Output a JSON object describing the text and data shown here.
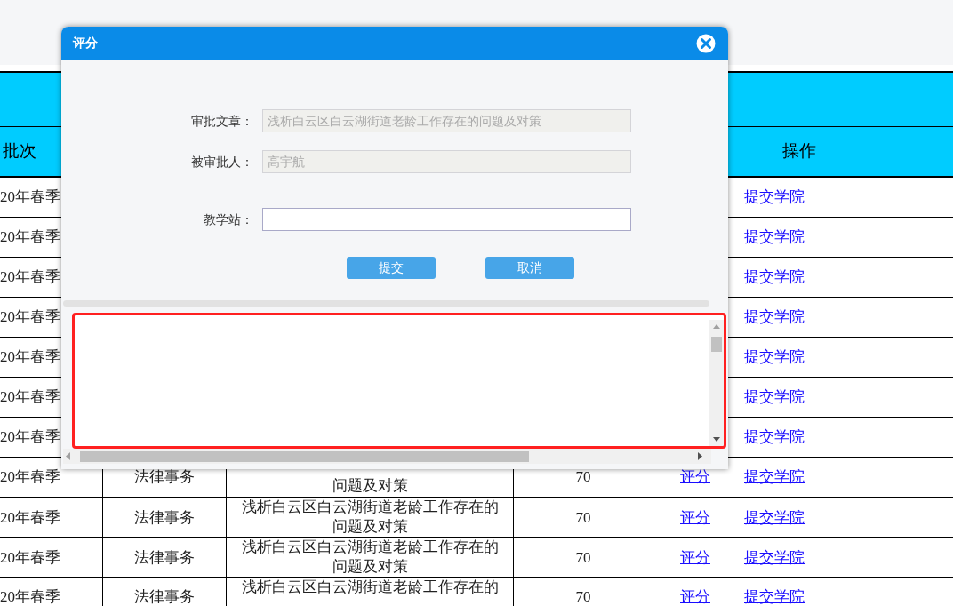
{
  "table": {
    "header": {
      "batch": "批次",
      "actions": "操作"
    },
    "rows": [
      {
        "batch": "20年春季",
        "submit_link": "提交学院"
      },
      {
        "batch": "20年春季",
        "submit_link": "提交学院"
      },
      {
        "batch": "20年春季",
        "submit_link": "提交学院"
      },
      {
        "batch": "20年春季",
        "submit_link": "提交学院"
      },
      {
        "batch": "20年春季",
        "submit_link": "提交学院"
      },
      {
        "batch": "20年春季",
        "submit_link": "提交学院"
      },
      {
        "batch": "20年春季",
        "submit_link": "提交学院"
      },
      {
        "batch": "20年春季",
        "major": "法律事务",
        "title_lines": [
          "问题及对策"
        ],
        "score": "70",
        "grade_link": "评分",
        "submit_link": "提交学院"
      },
      {
        "batch": "20年春季",
        "major": "法律事务",
        "title_lines": [
          "浅析白云区白云湖街道老龄工作存在的",
          "问题及对策"
        ],
        "score": "70",
        "grade_link": "评分",
        "submit_link": "提交学院"
      },
      {
        "batch": "20年春季",
        "major": "法律事务",
        "title_lines": [
          "浅析白云区白云湖街道老龄工作存在的",
          "问题及对策"
        ],
        "score": "70",
        "grade_link": "评分",
        "submit_link": "提交学院"
      },
      {
        "batch": "20年春季",
        "major": "法律事务",
        "title_lines": [
          "浅析白云区白云湖街道老龄工作存在的"
        ],
        "score": "70",
        "grade_link": "评分",
        "submit_link": "提交学院"
      }
    ]
  },
  "dialog": {
    "title": "评分",
    "fields": [
      {
        "label": "审批文章：",
        "value": "浅析白云区白云湖街道老龄工作存在的问题及对策",
        "disabled": true
      },
      {
        "label": "被审批人：",
        "value": "高宇航",
        "disabled": true
      },
      {
        "label": "教学站：",
        "disabled": false
      }
    ],
    "buttons": [
      "提交",
      "取消"
    ],
    "highlighted": true
  }
}
